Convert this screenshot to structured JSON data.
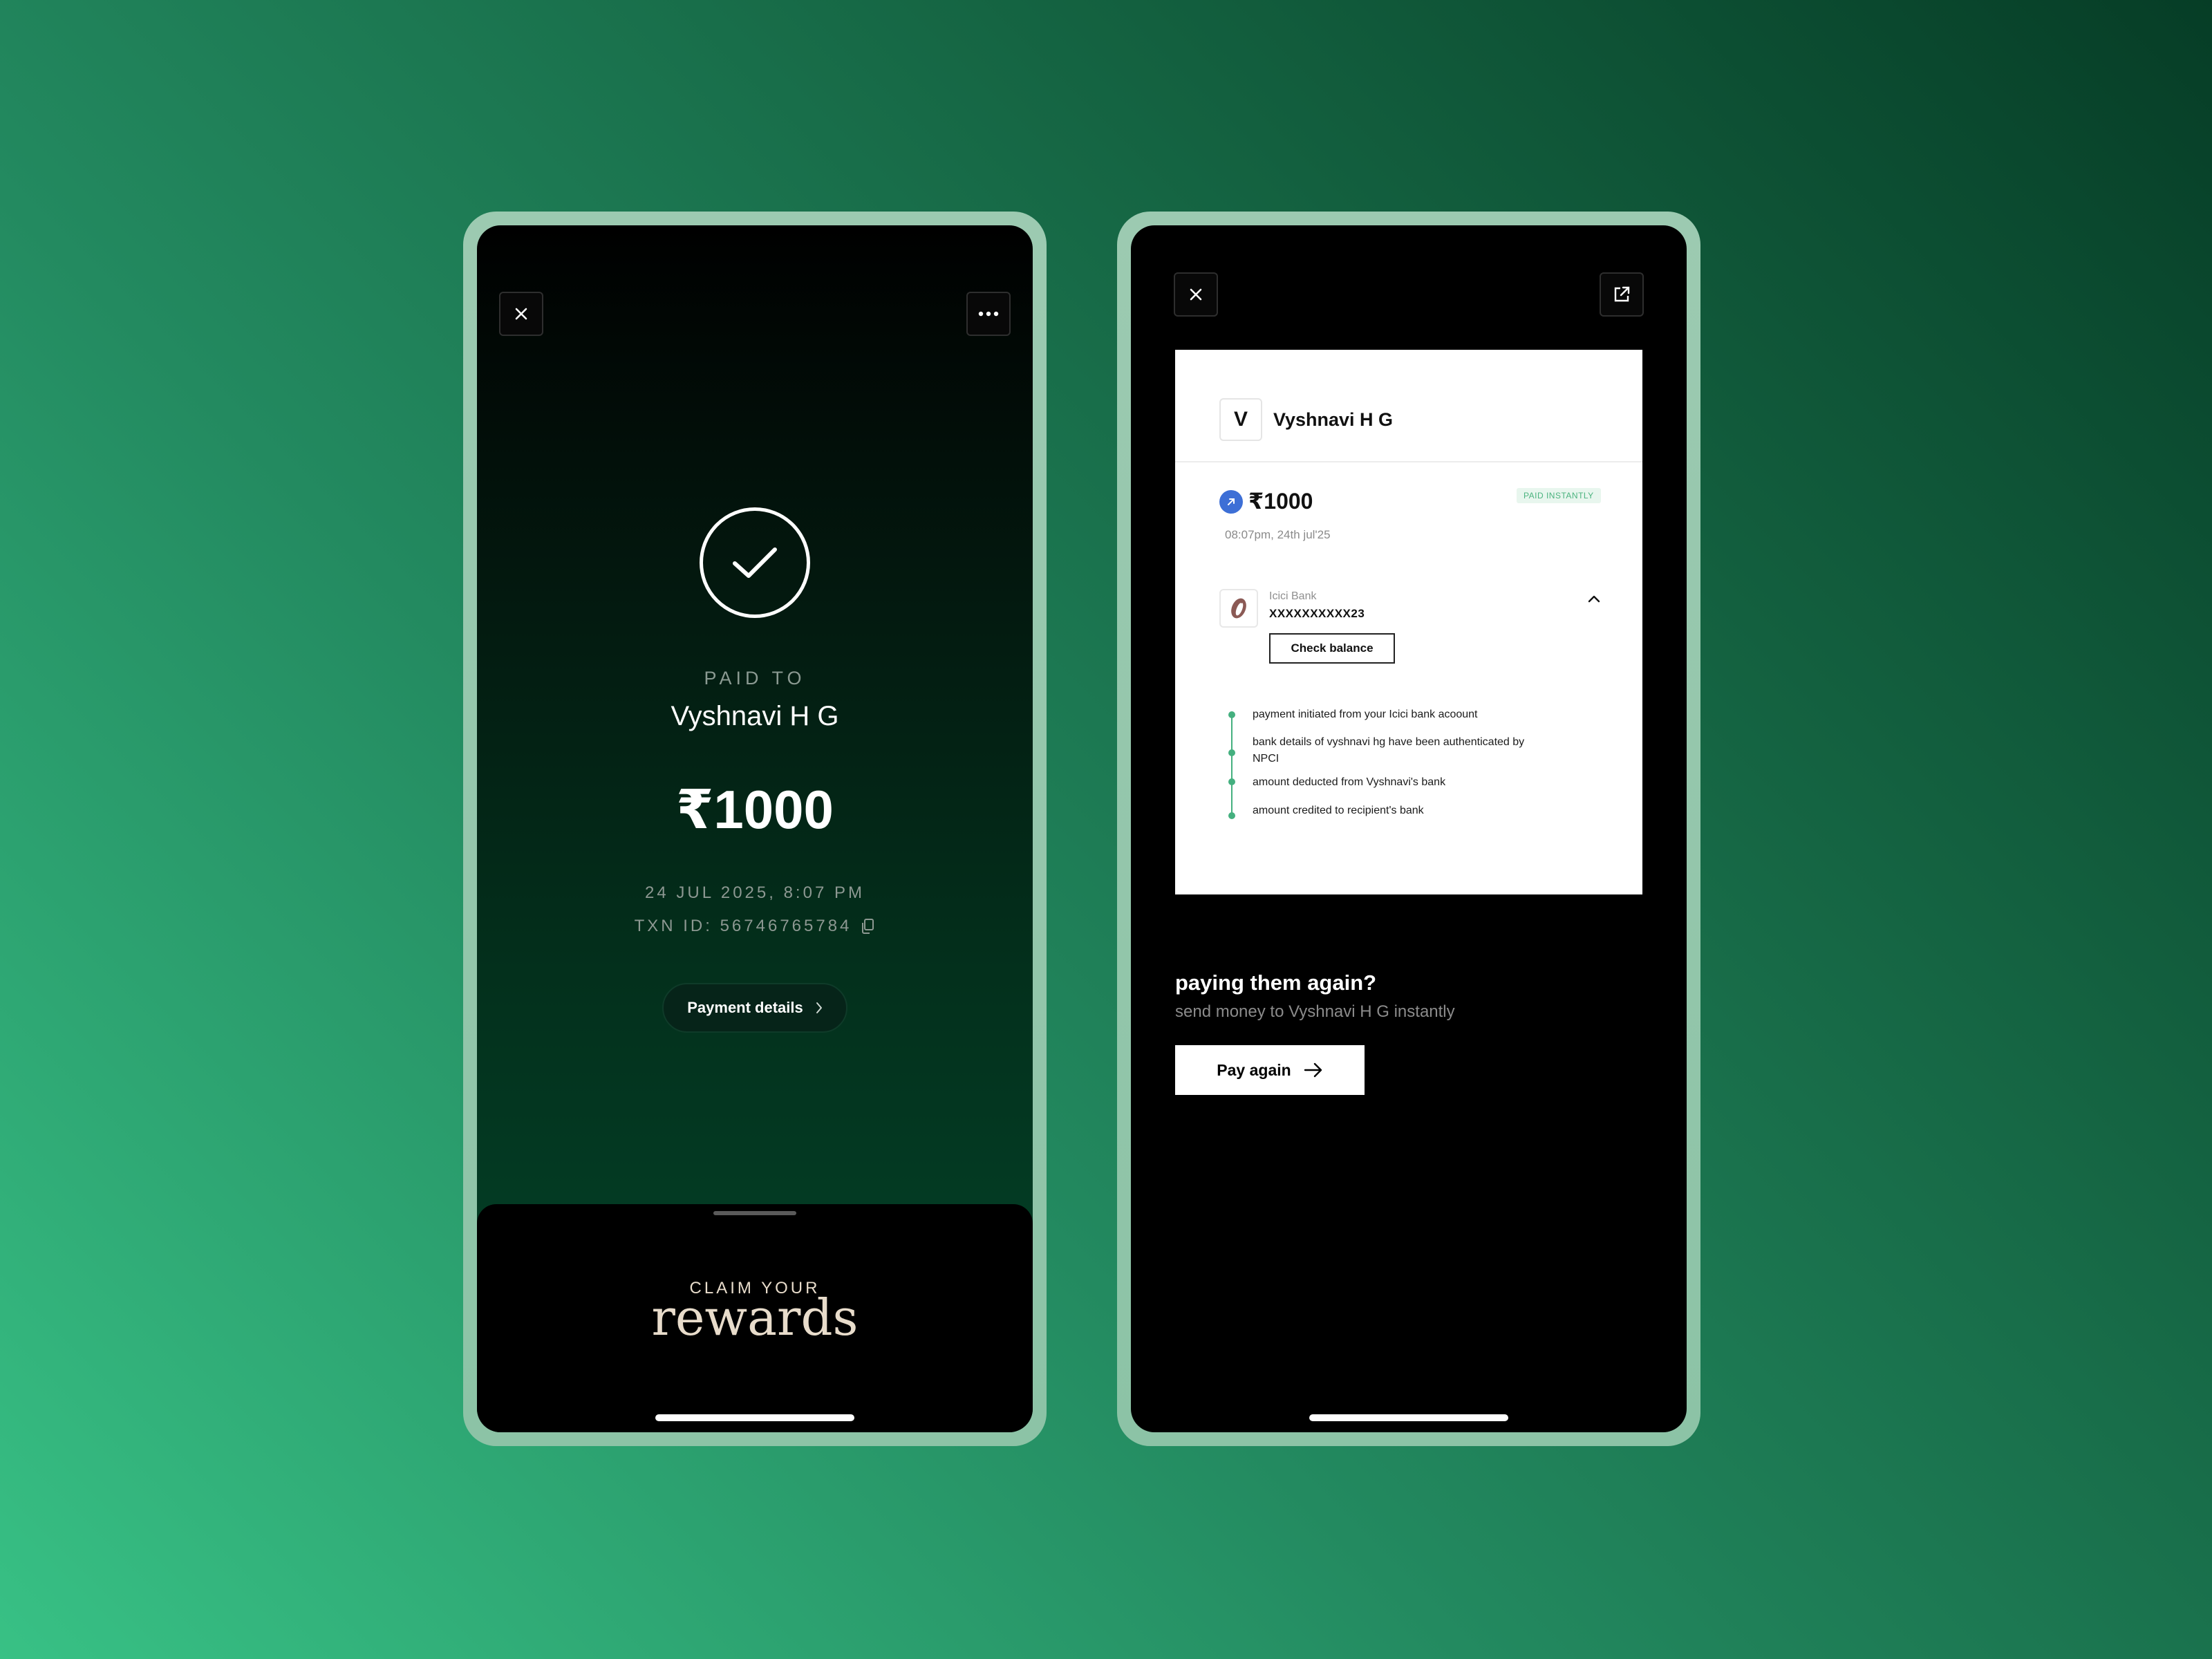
{
  "success_screen": {
    "paid_to_label": "PAID TO",
    "payee_name": "Vyshnavi H G",
    "amount": "₹1000",
    "datetime": "24 JUL 2025, 8:07 PM",
    "txn_id": "TXN ID: 56746765784",
    "payment_details_label": "Payment details",
    "rewards": {
      "claim_label": "CLAIM YOUR",
      "rewards_word": "rewards"
    },
    "icons": [
      "close-icon",
      "more-icon",
      "check-icon",
      "copy-icon",
      "chevron-right-icon"
    ]
  },
  "receipt_screen": {
    "avatar_initial": "V",
    "payee_name": "Vyshnavi H G",
    "amount": "₹1000",
    "status_badge": "PAID INSTANTLY",
    "time": "08:07pm, 24th jul'25",
    "bank": {
      "name": "Icici Bank",
      "account": "XXXXXXXXXX23",
      "check_balance_label": "Check balance"
    },
    "timeline": [
      "payment initiated from your Icici bank acoount",
      "bank details of vyshnavi hg have been authenticated by NPCI",
      "amount deducted from Vyshnavi's bank",
      "amount credited to recipient's bank"
    ],
    "pay_again": {
      "title": "paying them again?",
      "subtitle": "send money to Vyshnavi H G instantly",
      "button_label": "Pay again"
    },
    "icons": [
      "close-icon",
      "share-icon",
      "sent-arrow-icon",
      "chevron-up-icon",
      "arrow-right-icon"
    ]
  },
  "colors": {
    "accent_green": "#44b07f",
    "sent_blue": "#3d6fd6",
    "badge_bg": "#e8f6ee",
    "rewards_cream": "#e8dccb"
  }
}
